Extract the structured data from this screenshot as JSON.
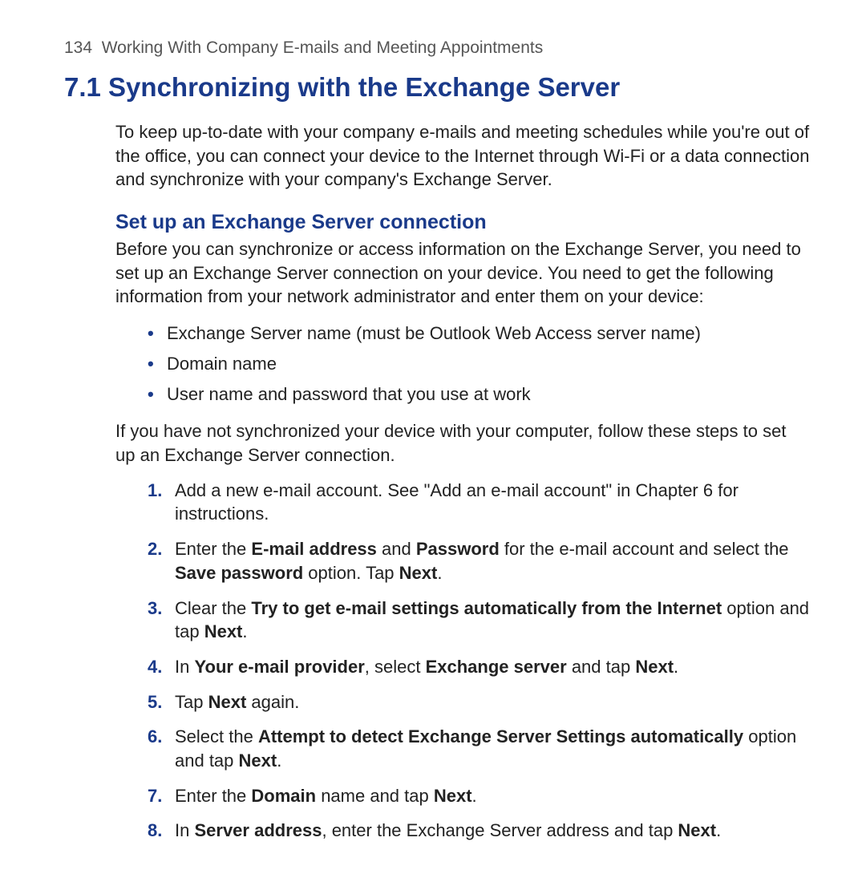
{
  "header": {
    "page_number": "134",
    "chapter_title": "Working With Company E-mails and Meeting Appointments"
  },
  "section": {
    "number": "7.1",
    "title": "Synchronizing with the Exchange Server",
    "intro": "To keep up-to-date with your company e-mails and meeting schedules while you're out of the office, you can connect your device to the Internet through Wi-Fi or a data connection and synchronize with your company's Exchange Server."
  },
  "subsection": {
    "title": "Set up an Exchange Server connection",
    "preamble": "Before you can synchronize or access information on the Exchange Server, you need to set up an Exchange Server connection on your device. You need to get the following information from your network administrator and enter them on your device:",
    "info_items": [
      "Exchange Server name (must be Outlook Web Access server name)",
      "Domain name",
      "User name and password that you use at work"
    ],
    "transition": "If you have not synchronized your device with your computer, follow these steps to set up an Exchange Server connection.",
    "steps": [
      {
        "html": "Add a new e-mail account. See \"Add an e-mail account\" in Chapter 6 for instructions."
      },
      {
        "html": "Enter the <b>E-mail address</b> and <b>Password</b> for the e-mail account and select the <b>Save password</b> option. Tap <b>Next</b>."
      },
      {
        "html": "Clear the <b>Try to get e-mail settings automatically from the Internet</b> option and tap <b>Next</b>."
      },
      {
        "html": "In <b>Your e-mail provider</b>, select <b>Exchange server</b> and tap <b>Next</b>."
      },
      {
        "html": "Tap <b>Next</b> again."
      },
      {
        "html": "Select the <b>Attempt to detect Exchange Server Settings automatically</b> option and tap <b>Next</b>."
      },
      {
        "html": "Enter the <b>Domain</b> name and tap <b>Next</b>."
      },
      {
        "html": "In <b>Server address</b>, enter the Exchange Server address and tap <b>Next</b>."
      }
    ]
  }
}
